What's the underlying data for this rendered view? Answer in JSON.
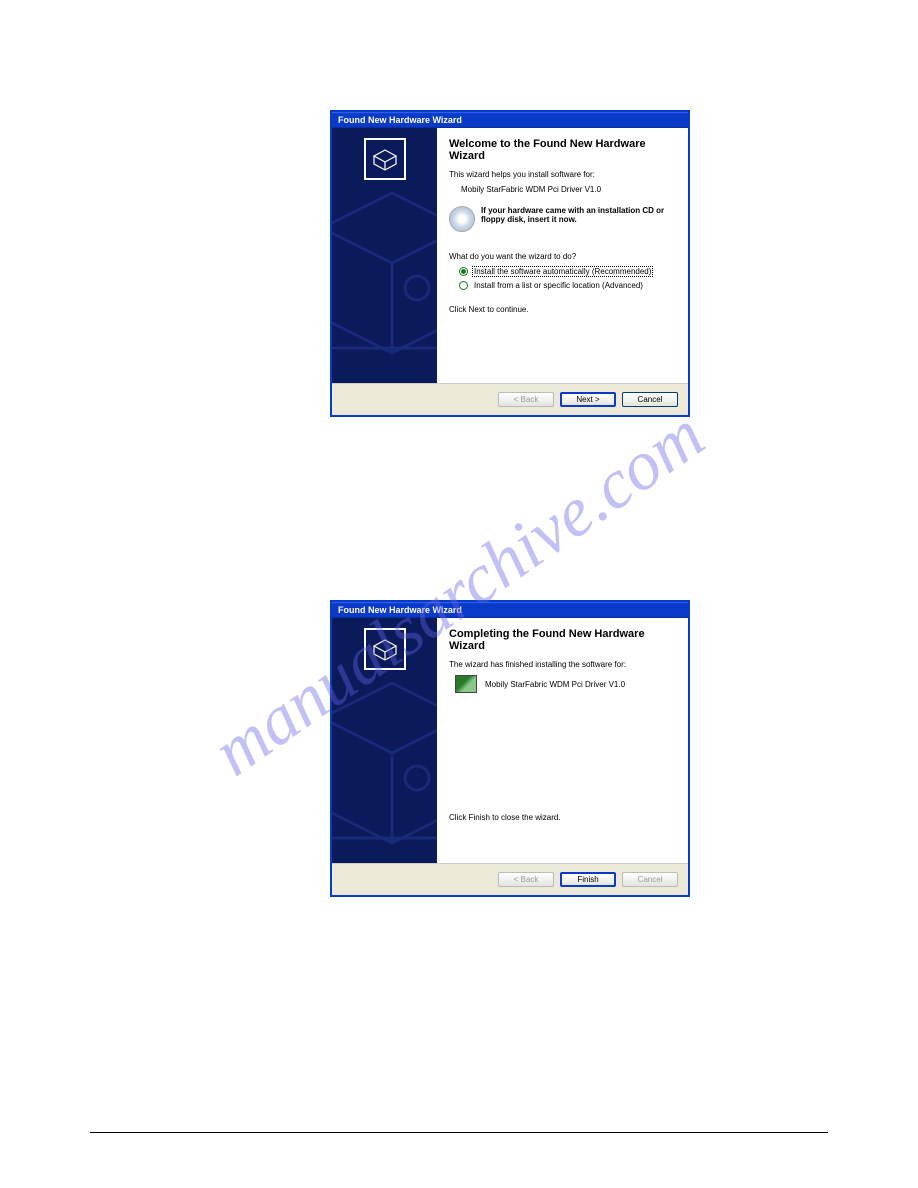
{
  "watermark": "manualsarchive.com",
  "dialog1": {
    "title": "Found New Hardware Wizard",
    "heading": "Welcome to the Found New Hardware Wizard",
    "desc": "This wizard helps you install software for:",
    "driver": "Mobily StarFabric WDM Pci Driver V1.0",
    "cd_text": "If your hardware came with an installation CD or floppy disk, insert it now.",
    "question": "What do you want the wizard to do?",
    "radio1": "Install the software automatically (Recommended)",
    "radio2": "Install from a list or specific location (Advanced)",
    "continue": "Click Next to continue.",
    "back": "< Back",
    "next": "Next >",
    "cancel": "Cancel"
  },
  "dialog2": {
    "title": "Found New Hardware Wizard",
    "heading": "Completing the Found New Hardware Wizard",
    "desc": "The wizard has finished installing the software for:",
    "driver": "Mobily StarFabric WDM Pci Driver V1.0",
    "continue": "Click Finish to close the wizard.",
    "back": "< Back",
    "finish": "Finish",
    "cancel": "Cancel"
  }
}
